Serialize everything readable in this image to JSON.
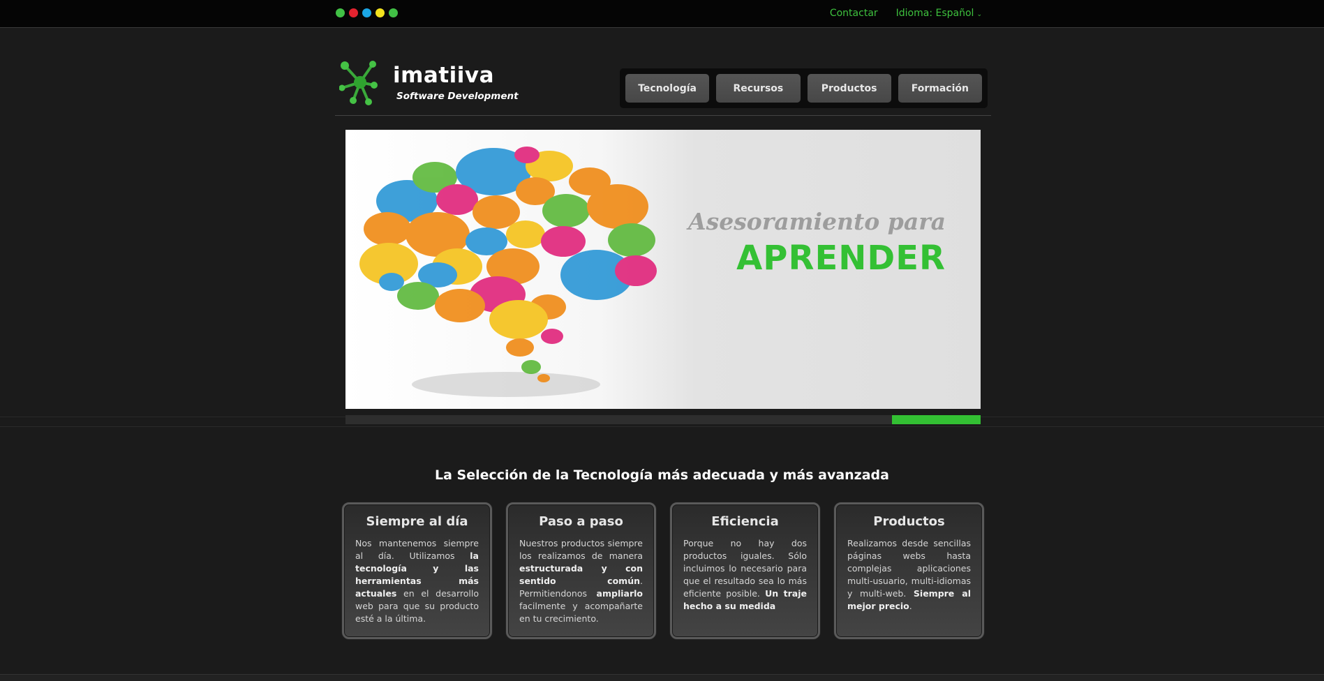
{
  "topbar": {
    "dots": [
      "#41c045",
      "#e3232f",
      "#1ba6e5",
      "#f2e21e",
      "#41c045"
    ],
    "contact_label": "Contactar",
    "language_label": "Idioma: Español",
    "language_caret": "⌄"
  },
  "logo": {
    "name": "imatiiva",
    "tagline": "Software Development"
  },
  "nav": {
    "items": [
      {
        "label": "Tecnología"
      },
      {
        "label": "Recursos"
      },
      {
        "label": "Productos"
      },
      {
        "label": "Formación"
      }
    ]
  },
  "slider": {
    "heading_small": "Asesoramiento para",
    "heading_large": "APRENDER",
    "progress": 0.14
  },
  "section": {
    "title": "La Selección de la Tecnología más adecuada y más avanzada"
  },
  "cards": [
    {
      "title": "Siempre al día",
      "p1": "Nos mantenemos siempre al día. Utilizamos ",
      "b1": "la tecnología y las herramientas más actuales",
      "p2": " en el desarrollo web para que su producto esté a la última.",
      "b2": "",
      "p3": ""
    },
    {
      "title": "Paso a paso",
      "p1": "Nuestros productos siempre los realizamos de manera ",
      "b1": "estructurada y con sentido común",
      "p2": ". Permitiendonos ",
      "b2": "ampliarlo",
      "p3": " facilmente y acompañarte en tu crecimiento."
    },
    {
      "title": "Eficiencia",
      "p1": "Porque no hay dos productos iguales. Sólo incluimos lo necesario para que el resultado sea lo más eficiente posible. ",
      "b1": "Un traje hecho a su medida",
      "p2": "",
      "b2": "",
      "p3": ""
    },
    {
      "title": "Productos",
      "p1": "Realizamos desde sencillas páginas webs hasta complejas aplicaciones multi-usuario, multi-idiomas y multi-web. ",
      "b1": "Siempre al mejor precio",
      "p2": ".",
      "b2": "",
      "p3": ""
    }
  ]
}
